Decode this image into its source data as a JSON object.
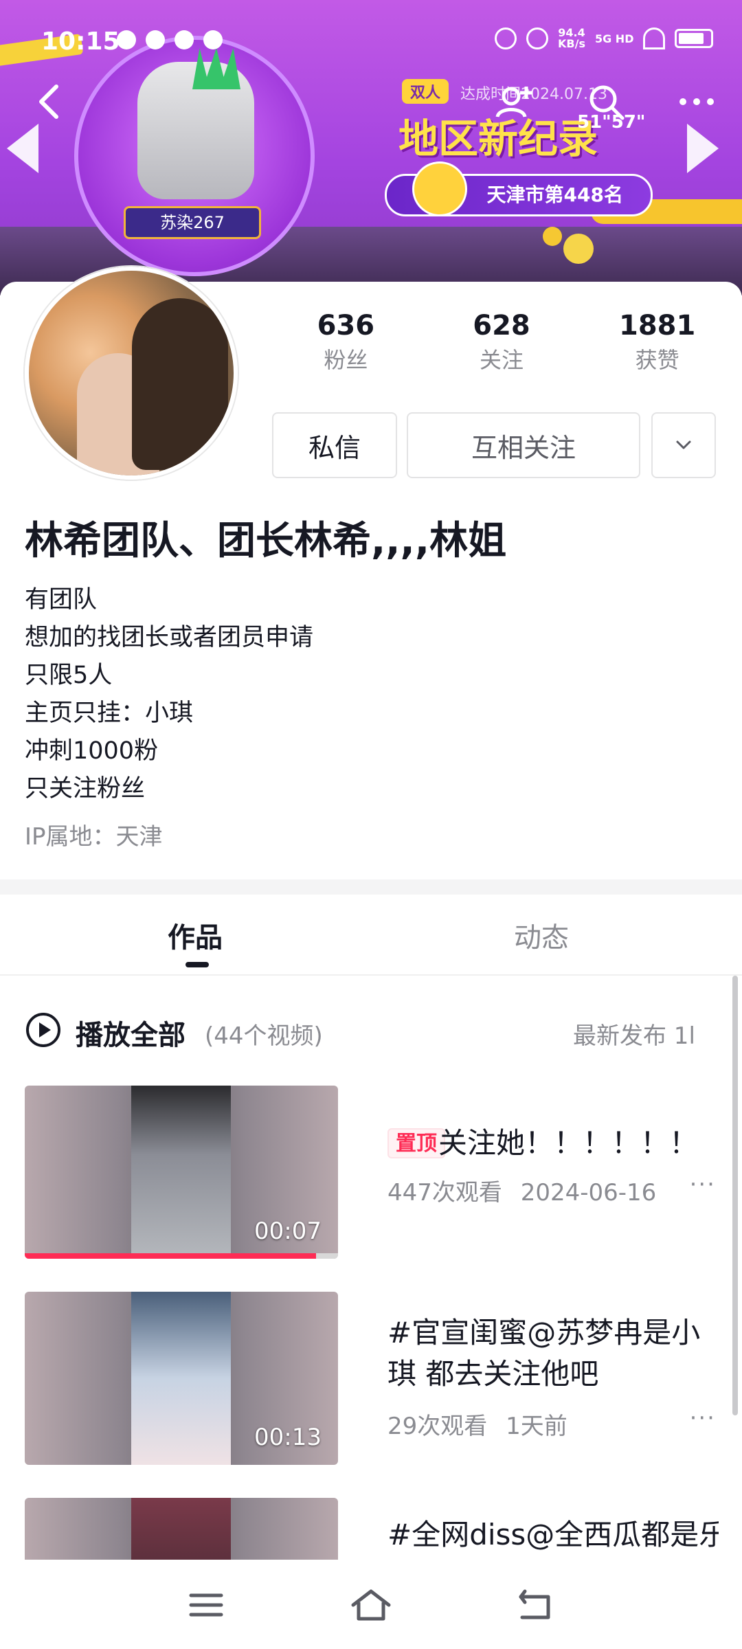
{
  "status_bar": {
    "time": "10:15",
    "net_speed_value": "94.4",
    "net_speed_unit": "KB/s",
    "signal_label": "5G HD"
  },
  "banner": {
    "player_name": "苏染267",
    "record_tag": "双人",
    "record_subtitle": "达成时间2024.07.13",
    "record_title": "地区新纪录",
    "record_time": "51\"57\"",
    "rank_text": "天津市第448名"
  },
  "profile": {
    "stats": [
      {
        "value": "636",
        "label": "粉丝"
      },
      {
        "value": "628",
        "label": "关注"
      },
      {
        "value": "1881",
        "label": "获赞"
      }
    ],
    "message_button": "私信",
    "follow_button": "互相关注",
    "nickname": "林希团队、团长林希,,,,林姐",
    "bio_lines": [
      "有团队",
      "想加的找团长或者团员申请",
      "只限5人",
      "主页只挂：小琪",
      "冲刺1000粉",
      "只关注粉丝"
    ],
    "ip_location": "IP属地：天津"
  },
  "tabs": [
    {
      "label": "作品"
    },
    {
      "label": "动态"
    }
  ],
  "play_all": {
    "label": "播放全部",
    "count": "(44个视频)",
    "sort_label": "最新发布 1l"
  },
  "videos": [
    {
      "pinned_label": "置顶",
      "title": "关注她！！！！！！",
      "title_line2": "",
      "views": "447次观看",
      "date": "2024-06-16",
      "duration": "00:07",
      "progress": 0.93
    },
    {
      "pinned_label": "",
      "title": "#官宣闺蜜@苏梦冉是小",
      "title_line2": "琪 都去关注他吧",
      "views": "29次观看",
      "date": "1天前",
      "duration": "00:13",
      "progress": 0
    },
    {
      "pinned_label": "",
      "title": "#全网diss@全西瓜都是乐",
      "title_line2": "",
      "views": "",
      "date": "",
      "duration": "",
      "progress": 0
    }
  ],
  "more_symbol": "···",
  "colors": {
    "accent": "#fe2c55",
    "text_primary": "#161823",
    "text_secondary": "#8a8b91",
    "banner_purple": "#a444e0",
    "record_yellow": "#ffe24a"
  }
}
